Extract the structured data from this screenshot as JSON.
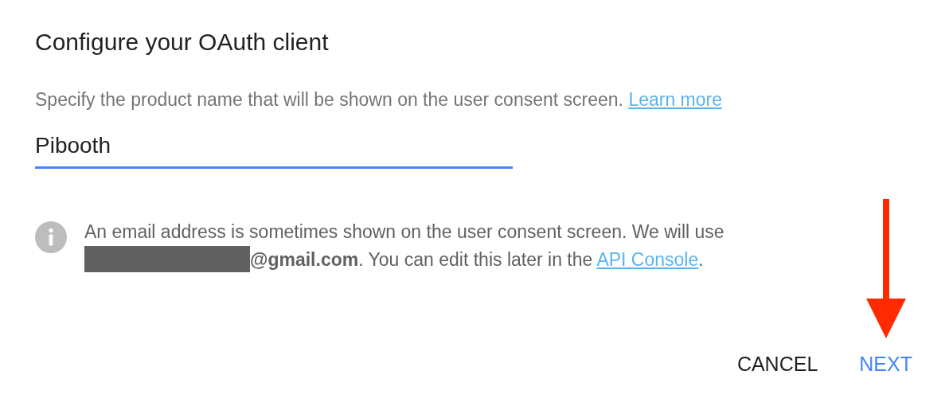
{
  "dialog": {
    "title": "Configure your OAuth client",
    "description": {
      "text": "Specify the product name that will be shown on the user consent screen.",
      "link": "Learn more"
    },
    "product_name": {
      "value": "Pibooth",
      "focused": true
    },
    "notice": {
      "text": "An email address is sometimes shown on the user consent screen. We will use",
      "email": "@gmail.com",
      "text_after": ". You can edit this later in the",
      "link": "API Console",
      "end": "."
    },
    "buttons": [
      {
        "label": "CANCEL",
        "kind": "plain"
      },
      {
        "label": "NEXT",
        "kind": "primary"
      }
    ]
  },
  "annotation": {
    "kind": "arrow"
  }
}
